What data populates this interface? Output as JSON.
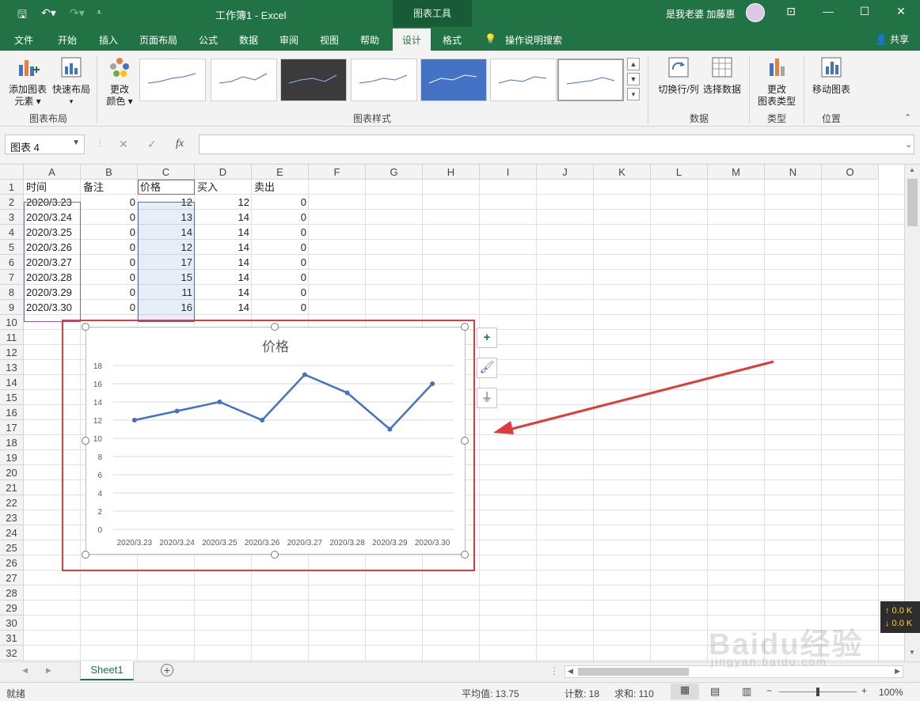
{
  "window": {
    "title": "工作簿1 - Excel",
    "context_tools": "图表工具",
    "user": "是我老婆 加藤惠"
  },
  "tabs": [
    "文件",
    "开始",
    "插入",
    "页面布局",
    "公式",
    "数据",
    "审阅",
    "视图",
    "帮助",
    "设计",
    "格式"
  ],
  "active_tab": "设计",
  "tell_me": "操作说明搜索",
  "share": "共享",
  "ribbon": {
    "add_element": "添加图表",
    "add_element2": "元素",
    "quick_layout": "快速布局",
    "layout_group": "图表布局",
    "change_color": "更改",
    "change_color2": "颜色",
    "styles_group": "图表样式",
    "switch_row_col": "切换行/列",
    "select_data": "选择数据",
    "data_group": "数据",
    "change_type": "更改",
    "change_type2": "图表类型",
    "type_group": "类型",
    "move_chart": "移动图表",
    "location_group": "位置"
  },
  "formula_bar": {
    "name_box": "图表 4",
    "fx": "fx",
    "value": ""
  },
  "columns": [
    "A",
    "B",
    "C",
    "D",
    "E",
    "F",
    "G",
    "H",
    "I",
    "J",
    "K",
    "L",
    "M",
    "N",
    "O"
  ],
  "rows": [
    "1",
    "2",
    "3",
    "4",
    "5",
    "6",
    "7",
    "8",
    "9",
    "10",
    "11",
    "12",
    "13",
    "14",
    "15",
    "16",
    "17",
    "18",
    "19",
    "20",
    "21",
    "22",
    "23",
    "24",
    "25",
    "26",
    "27",
    "28",
    "29",
    "30",
    "31",
    "32"
  ],
  "table": {
    "headers": [
      "时间",
      "备注",
      "价格",
      "买入",
      "卖出"
    ],
    "rows": [
      [
        "2020/3.23",
        "0",
        "12",
        "12",
        "0"
      ],
      [
        "2020/3.24",
        "0",
        "13",
        "14",
        "0"
      ],
      [
        "2020/3.25",
        "0",
        "14",
        "14",
        "0"
      ],
      [
        "2020/3.26",
        "0",
        "12",
        "14",
        "0"
      ],
      [
        "2020/3.27",
        "0",
        "17",
        "14",
        "0"
      ],
      [
        "2020/3.28",
        "0",
        "15",
        "14",
        "0"
      ],
      [
        "2020/3.29",
        "0",
        "11",
        "14",
        "0"
      ],
      [
        "2020/3.30",
        "0",
        "16",
        "14",
        "0"
      ]
    ]
  },
  "chart_data": {
    "type": "line",
    "title": "价格",
    "categories": [
      "2020/3.23",
      "2020/3.24",
      "2020/3.25",
      "2020/3.26",
      "2020/3.27",
      "2020/3.28",
      "2020/3.29",
      "2020/3.30"
    ],
    "series": [
      {
        "values": [
          12,
          13,
          14,
          12,
          17,
          15,
          11,
          16
        ],
        "color": "#4472c4"
      }
    ],
    "yticks": [
      "0",
      "2",
      "4",
      "6",
      "8",
      "10",
      "12",
      "14",
      "16",
      "18"
    ],
    "ylim": [
      0,
      18
    ],
    "grid": true
  },
  "sheet_tab": "Sheet1",
  "status": {
    "ready": "就绪",
    "average": "平均值: 13.75",
    "count": "计数: 18",
    "sum": "求和: 110",
    "zoom": "100%"
  },
  "netmon": {
    "up": "↑ 0.0 K",
    "down": "↓ 0.0 K"
  },
  "watermark": {
    "main": "Baidu经验",
    "sub": "jingyan.baidu.com"
  },
  "colors": {
    "excel_green": "#217346",
    "series": "#4472c4",
    "annotation_red": "#e03a3a"
  }
}
